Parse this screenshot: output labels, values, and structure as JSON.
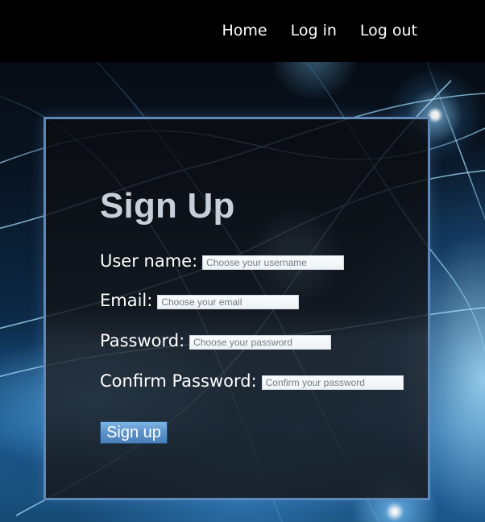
{
  "nav": {
    "items": [
      {
        "label": "Home"
      },
      {
        "label": "Log in"
      },
      {
        "label": "Log out"
      }
    ]
  },
  "form": {
    "title": "Sign Up",
    "fields": [
      {
        "label": "User name:",
        "placeholder": "Choose your username",
        "value": ""
      },
      {
        "label": "Email:",
        "placeholder": "Choose your email",
        "value": ""
      },
      {
        "label": "Password:",
        "placeholder": "Choose your password",
        "value": ""
      },
      {
        "label": "Confirm Password:",
        "placeholder": "Confirm your password",
        "value": ""
      }
    ],
    "submit_label": "Sign up"
  },
  "colors": {
    "topbar": "#000000",
    "panel_border": "#5d88b7",
    "title": "#c7cfd8",
    "button": "#5f95cb"
  }
}
